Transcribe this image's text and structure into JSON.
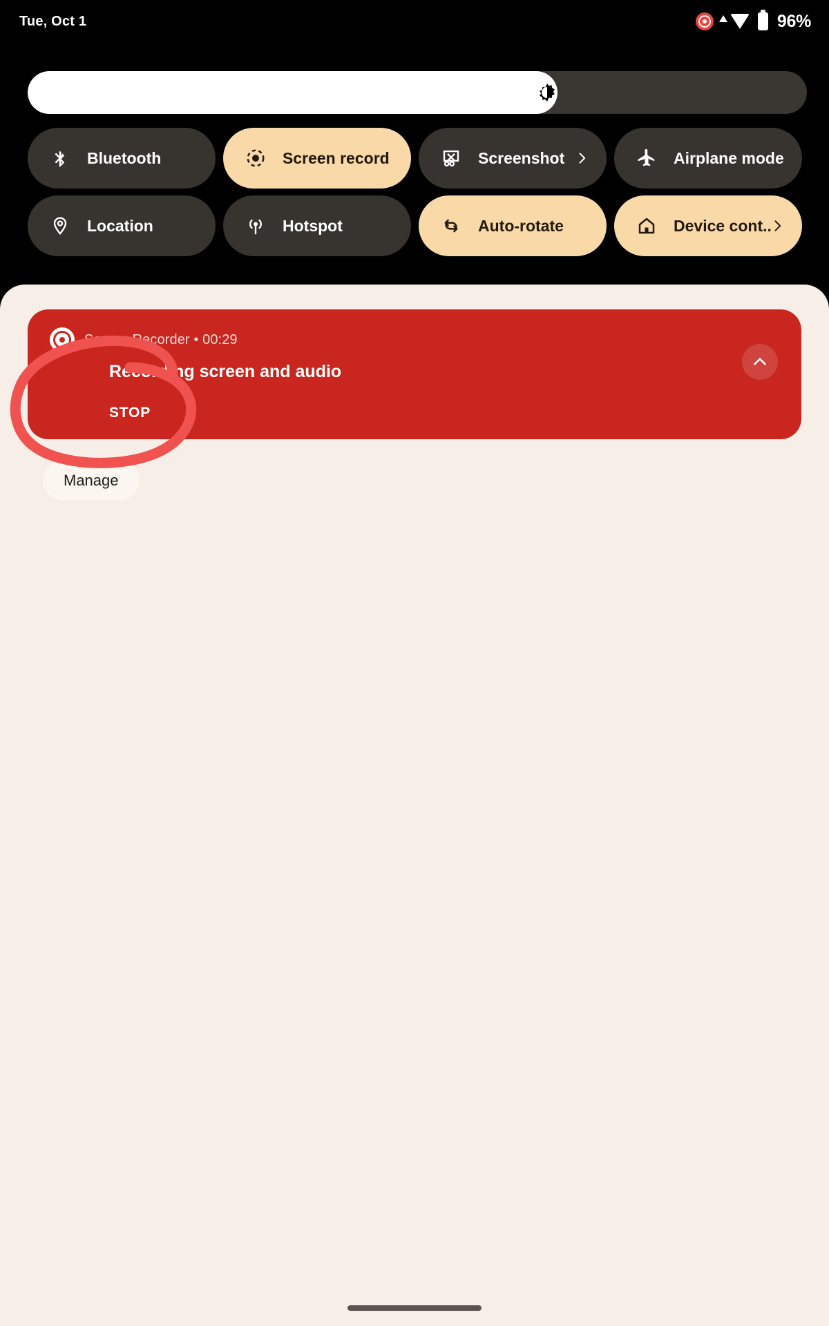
{
  "status_bar": {
    "clock": "Tue, Oct 1",
    "battery_percent": "96%",
    "icons": [
      "screen-recording-icon",
      "cellular-signal-icon",
      "wifi-icon",
      "battery-icon"
    ]
  },
  "brightness": {
    "label": "Brightness",
    "icon": "brightness-icon",
    "level_percent": 68
  },
  "tiles": [
    {
      "label": "Bluetooth",
      "icon": "bluetooth-icon",
      "state": "off",
      "chevron": false
    },
    {
      "label": "Screen record",
      "icon": "screen-record-icon",
      "state": "on",
      "chevron": false
    },
    {
      "label": "Screenshot",
      "icon": "screenshot-icon",
      "state": "off",
      "chevron": true
    },
    {
      "label": "Airplane mode",
      "icon": "airplane-icon",
      "state": "off",
      "chevron": false
    },
    {
      "label": "Location",
      "icon": "location-pin-icon",
      "state": "off",
      "chevron": false
    },
    {
      "label": "Hotspot",
      "icon": "hotspot-icon",
      "state": "off",
      "chevron": false
    },
    {
      "label": "Auto-rotate",
      "icon": "auto-rotate-icon",
      "state": "on",
      "chevron": false
    },
    {
      "label": "Device cont..",
      "icon": "device-controls-icon",
      "state": "on",
      "chevron": true
    }
  ],
  "notification": {
    "app_icon": "screen-recorder-icon",
    "source": "Screen Recorder • 00:29",
    "app_name": "Screen Recorder",
    "elapsed": "00:29",
    "title": "Recording screen and audio",
    "action_label": "STOP",
    "collapse_icon": "chevron-up-icon"
  },
  "manage": {
    "label": "Manage"
  },
  "annotation": {
    "shape": "hand-drawn-oval",
    "color": "#F0534F",
    "target": "STOP"
  },
  "colors": {
    "background": "#000000",
    "shade": "#F7EFE7",
    "tile_off": "#37332E",
    "tile_on": "#F9D9A8",
    "notification": "#C8261F",
    "accent_annotation": "#F0534F"
  },
  "home_indicator": "home-gesture-bar"
}
